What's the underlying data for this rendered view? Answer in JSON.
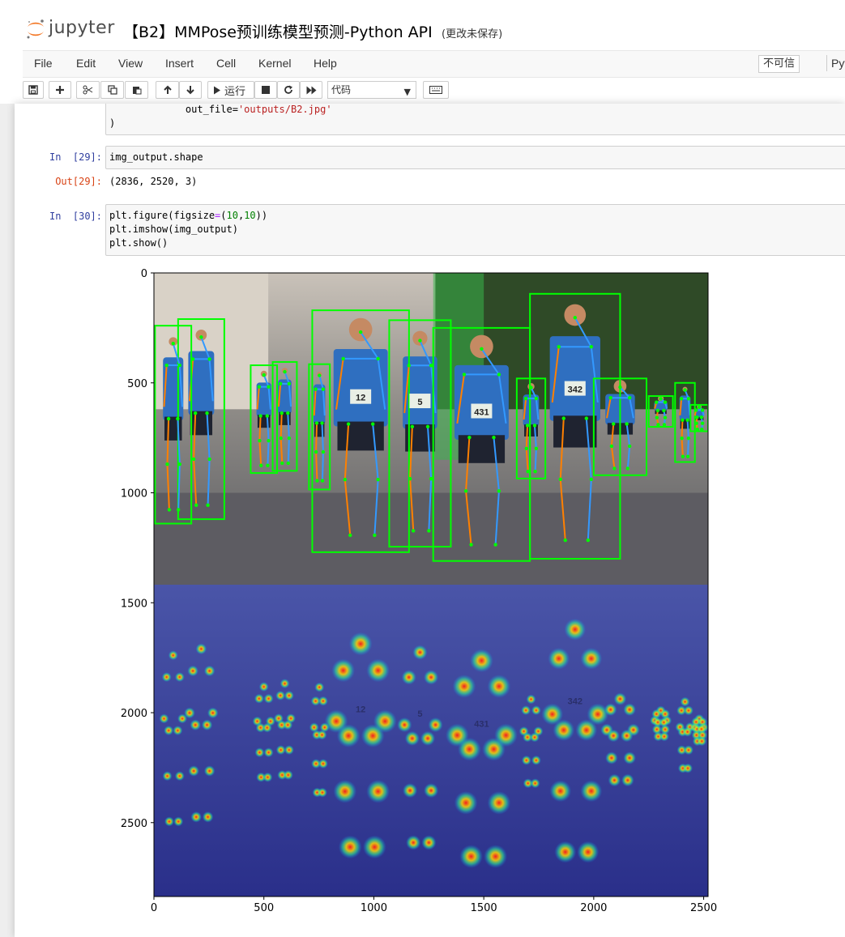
{
  "app": {
    "logo_text": "jupyter",
    "notebook_title": "【B2】MMPose预训练模型预测-Python API",
    "save_status": "(更改未保存)"
  },
  "menu": {
    "items": [
      "File",
      "Edit",
      "View",
      "Insert",
      "Cell",
      "Kernel",
      "Help"
    ],
    "trust_label": "不可信",
    "kernel_label": "Pyt"
  },
  "toolbar": {
    "run_label": "运行",
    "cell_type": "代码",
    "icons": [
      "save-icon",
      "plus-icon",
      "scissors-icon",
      "copy-icon",
      "paste-icon",
      "arrow-up-icon",
      "arrow-down-icon",
      "play-icon",
      "stop-icon",
      "restart-icon",
      "fast-forward-icon",
      "keyboard-icon"
    ]
  },
  "cells": {
    "prev": {
      "line1_pre": "             out_file=",
      "line1_str": "'outputs/B2.jpg'",
      "line2": ")"
    },
    "c29": {
      "in_prompt": "In  [29]:",
      "code": "img_output.shape",
      "out_prompt": "Out[29]:",
      "output": "(2836, 2520, 3)"
    },
    "c30": {
      "in_prompt": "In  [30]:",
      "l1_a": "plt.figure(figsize",
      "l1_op": "=",
      "l1_b": "(",
      "l1_n1": "10",
      "l1_c": ",",
      "l1_n2": "10",
      "l1_d": "))",
      "l2": "plt.imshow(img_output)",
      "l3": "plt.show()"
    }
  },
  "colors": {
    "bbox": "#00ff00",
    "limb_left": "#ff8000",
    "limb_right": "#3399ff",
    "heatmap_bg": "#2a2f8a",
    "in_prompt": "#303f9f",
    "out_prompt": "#d84315"
  },
  "chart_data": {
    "type": "image",
    "title": "",
    "xlabel": "",
    "ylabel": "",
    "xlim": [
      0,
      2520
    ],
    "ylim": [
      2836,
      0
    ],
    "xticks": [
      0,
      500,
      1000,
      1500,
      2000,
      2500
    ],
    "yticks": [
      0,
      500,
      1000,
      1500,
      2000,
      2500
    ],
    "bib_numbers": [
      "12",
      "5",
      "431",
      "342"
    ],
    "bboxes": [
      {
        "x0": 720,
        "y0": 170,
        "x1": 1160,
        "y1": 1270
      },
      {
        "x0": 1070,
        "y0": 215,
        "x1": 1350,
        "y1": 1245
      },
      {
        "x0": 1270,
        "y0": 250,
        "x1": 1710,
        "y1": 1310
      },
      {
        "x0": 1710,
        "y0": 95,
        "x1": 2120,
        "y1": 1300
      },
      {
        "x0": 110,
        "y0": 210,
        "x1": 320,
        "y1": 1120
      },
      {
        "x0": 5,
        "y0": 240,
        "x1": 170,
        "y1": 1140
      },
      {
        "x0": 440,
        "y0": 420,
        "x1": 560,
        "y1": 910
      },
      {
        "x0": 540,
        "y0": 405,
        "x1": 650,
        "y1": 900
      },
      {
        "x0": 705,
        "y0": 415,
        "x1": 800,
        "y1": 985
      },
      {
        "x0": 1650,
        "y0": 480,
        "x1": 1780,
        "y1": 935
      },
      {
        "x0": 2000,
        "y0": 480,
        "x1": 2240,
        "y1": 920
      },
      {
        "x0": 2250,
        "y0": 560,
        "x1": 2360,
        "y1": 700
      },
      {
        "x0": 2370,
        "y0": 500,
        "x1": 2460,
        "y1": 860
      },
      {
        "x0": 2440,
        "y0": 600,
        "x1": 2520,
        "y1": 720
      }
    ]
  }
}
